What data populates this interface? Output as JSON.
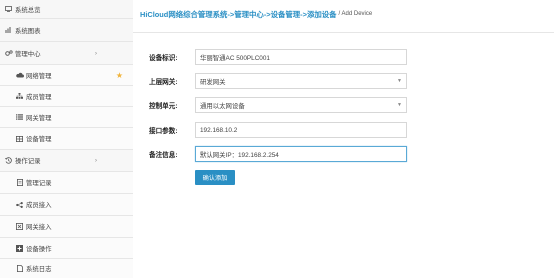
{
  "sidebar": {
    "items": [
      {
        "label": "系统总览",
        "icon": "monitor-icon",
        "type": "top"
      },
      {
        "label": "系统图表",
        "icon": "chart-icon",
        "type": "top"
      },
      {
        "label": "管理中心",
        "icon": "gears-icon",
        "type": "top",
        "expandable": true
      },
      {
        "label": "网络管理",
        "icon": "cloud-icon",
        "type": "sub",
        "starred": true
      },
      {
        "label": "成员管理",
        "icon": "sitemap-icon",
        "type": "sub"
      },
      {
        "label": "网关管理",
        "icon": "list-icon",
        "type": "sub"
      },
      {
        "label": "设备管理",
        "icon": "grid-icon",
        "type": "sub"
      },
      {
        "label": "操作记录",
        "icon": "history-icon",
        "type": "top",
        "expandable": true
      },
      {
        "label": "管理记录",
        "icon": "doc-icon",
        "type": "sub"
      },
      {
        "label": "成员接入",
        "icon": "share-icon",
        "type": "sub"
      },
      {
        "label": "网关接入",
        "icon": "close-box-icon",
        "type": "sub"
      },
      {
        "label": "设备操作",
        "icon": "plus-box-icon",
        "type": "sub"
      },
      {
        "label": "系统日志",
        "icon": "file-icon",
        "type": "sub"
      }
    ]
  },
  "breadcrumb": {
    "parts": [
      "HiCloud网络综合管理系统",
      "管理中心",
      "设备管理",
      "添加设备"
    ],
    "separator": "->",
    "current": "/ Add Device"
  },
  "form": {
    "device_id_label": "设备标识:",
    "device_id_value": "华丽智通AC 500PLC001",
    "gateway_label": "上层网关:",
    "gateway_value": "研发网关",
    "control_unit_label": "控制单元:",
    "control_unit_value": "通用以太网设备",
    "interface_label": "接口参数:",
    "interface_value": "192.168.10.2",
    "note_label": "备注信息:",
    "note_value": "默认网关IP：192.168.2.254",
    "submit_label": "确认添加"
  },
  "colors": {
    "accent": "#2a8fc4",
    "star": "#f0b33a"
  }
}
